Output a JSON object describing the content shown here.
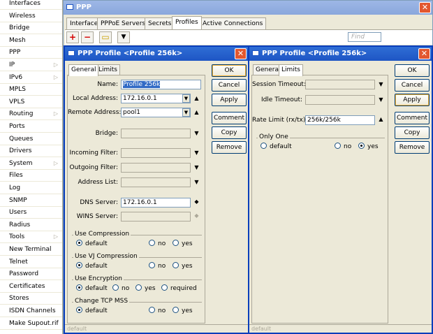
{
  "sidebar": {
    "items": [
      {
        "label": "Interfaces"
      },
      {
        "label": "Wireless"
      },
      {
        "label": "Bridge"
      },
      {
        "label": "Mesh"
      },
      {
        "label": "PPP"
      },
      {
        "label": "IP",
        "submenu": true
      },
      {
        "label": "IPv6",
        "submenu": true
      },
      {
        "label": "MPLS"
      },
      {
        "label": "VPLS"
      },
      {
        "label": "Routing",
        "submenu": true
      },
      {
        "label": "Ports"
      },
      {
        "label": "Queues"
      },
      {
        "label": "Drivers"
      },
      {
        "label": "System",
        "submenu": true
      },
      {
        "label": "Files"
      },
      {
        "label": "Log"
      },
      {
        "label": "SNMP"
      },
      {
        "label": "Users"
      },
      {
        "label": "Radius"
      },
      {
        "label": "Tools",
        "submenu": true
      },
      {
        "label": "New Terminal"
      },
      {
        "label": "Telnet"
      },
      {
        "label": "Password"
      },
      {
        "label": "Certificates"
      },
      {
        "label": "Stores"
      },
      {
        "label": "ISDN Channels"
      },
      {
        "label": "Make Supout.rif"
      }
    ]
  },
  "ppp_window": {
    "title": "PPP",
    "close": "✕",
    "tabs": [
      "Interface",
      "PPPoE Servers",
      "Secrets",
      "Profiles",
      "Active Connections"
    ],
    "active_tab": "Profiles",
    "toolbar": {
      "add": "+",
      "remove": "−",
      "comment": "▭",
      "filter": "▼"
    },
    "find_placeholder": "Find"
  },
  "dialog_general": {
    "title": "PPP Profile <Profile 256k>",
    "close": "✕",
    "tabs": [
      "General",
      "Limits"
    ],
    "active_tab": "General",
    "fields": {
      "name_label": "Name:",
      "name_value": "Profile 256k",
      "local_label": "Local Address:",
      "local_value": "172.16.0.1",
      "remote_label": "Remote Address:",
      "remote_value": "pool1",
      "bridge_label": "Bridge:",
      "bridge_value": "",
      "incoming_label": "Incoming Filter:",
      "incoming_value": "",
      "outgoing_label": "Outgoing Filter:",
      "outgoing_value": "",
      "addrlist_label": "Address List:",
      "addrlist_value": "",
      "dns_label": "DNS Server:",
      "dns_value": "172.16.0.1",
      "wins_label": "WINS Server:",
      "wins_value": ""
    },
    "groups": {
      "compression": {
        "title": "Use Compression",
        "options": [
          "default",
          "no",
          "yes"
        ],
        "selected": "default"
      },
      "vj": {
        "title": "Use VJ Compression",
        "options": [
          "default",
          "no",
          "yes"
        ],
        "selected": "default"
      },
      "encryption": {
        "title": "Use Encryption",
        "options": [
          "default",
          "no",
          "yes",
          "required"
        ],
        "selected": "default"
      },
      "tcpmss": {
        "title": "Change TCP MSS",
        "options": [
          "default",
          "no",
          "yes"
        ],
        "selected": "default"
      }
    },
    "buttons": [
      "OK",
      "Cancel",
      "Apply",
      "Comment",
      "Copy",
      "Remove"
    ],
    "status": "default"
  },
  "dialog_limits": {
    "title": "PPP Profile <Profile 256k>",
    "close": "✕",
    "tabs": [
      "General",
      "Limits"
    ],
    "active_tab": "Limits",
    "fields": {
      "session_label": "Session Timeout:",
      "session_value": "",
      "idle_label": "Idle Timeout:",
      "idle_value": "",
      "rate_label": "Rate Limit (rx/tx):",
      "rate_value": "256k/256k"
    },
    "only_one": {
      "title": "Only One",
      "options": [
        "default",
        "no",
        "yes"
      ],
      "selected": "yes"
    },
    "buttons": [
      "OK",
      "Cancel",
      "Apply",
      "Comment",
      "Copy",
      "Remove"
    ],
    "status": "default"
  },
  "colors": {
    "titlebar": "#1e55c4",
    "close": "#e2572f",
    "selection": "#316ac5"
  }
}
